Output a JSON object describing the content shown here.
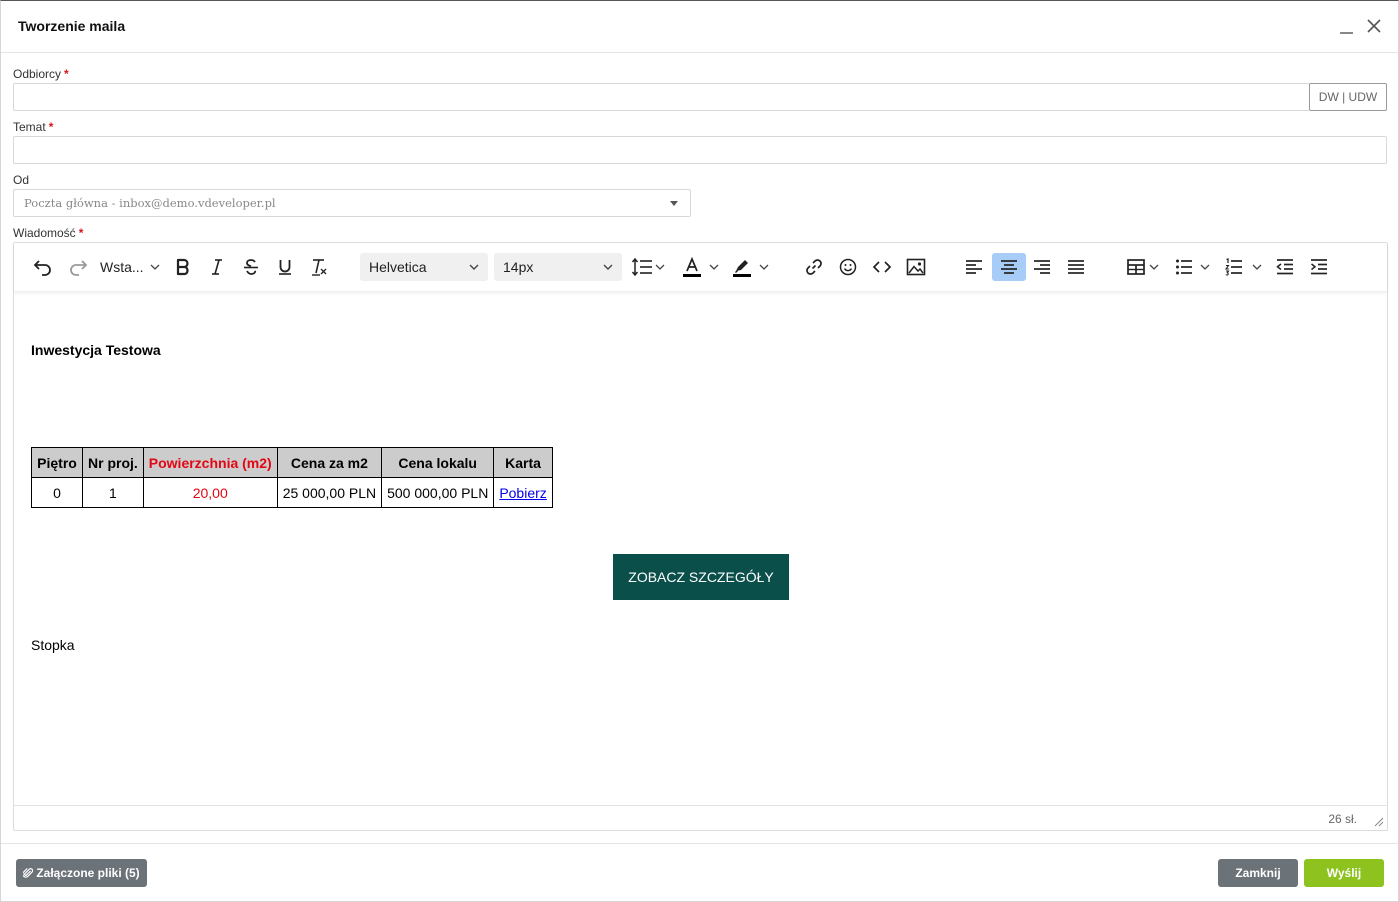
{
  "dialog": {
    "title": "Tworzenie maila"
  },
  "form": {
    "recipients_label": "Odbiorcy",
    "recipients_value": "",
    "cc_button": "DW | UDW",
    "subject_label": "Temat",
    "subject_value": "",
    "from_label": "Od",
    "from_value": "Poczta główna - inbox@demo.vdeveloper.pl",
    "message_label": "Wiadomość",
    "required_mark": "*"
  },
  "toolbar": {
    "insert_label": "Wsta...",
    "font_family": "Helvetica",
    "font_size": "14px",
    "active_align": "center"
  },
  "content": {
    "heading": "Inwestycja Testowa",
    "table": {
      "headers": [
        "Piętro",
        "Nr proj.",
        "Powierzchnia (m2)",
        "Cena za m2",
        "Cena lokalu",
        "Karta"
      ],
      "rows": [
        [
          "0",
          "1",
          "20,00",
          "25 000,00 PLN",
          "500 000,00 PLN",
          "Pobierz"
        ]
      ]
    },
    "cta_label": "ZOBACZ SZCZEGÓŁY",
    "footer": "Stopka",
    "word_count": "26 sł."
  },
  "buttons": {
    "attachments": "Załączone pliki (5)",
    "close": "Zamknij",
    "send": "Wyślij"
  },
  "colors": {
    "cta_bg": "#0b4f4a",
    "send_bg": "#8dc21f",
    "secondary_bg": "#6b7278",
    "required": "#d9141a",
    "highlight_column": "#e30613",
    "active_tool": "#a6ccf7"
  }
}
